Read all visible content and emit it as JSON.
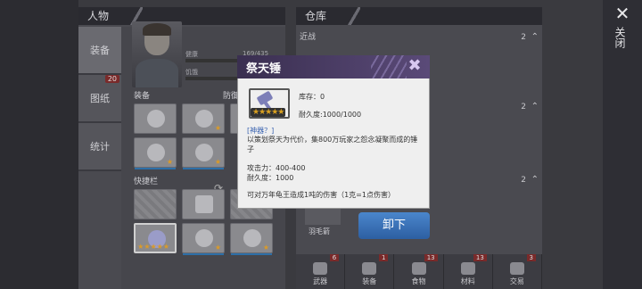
{
  "left_panel": {
    "title": "人物"
  },
  "side_tabs": [
    {
      "label": "装备"
    },
    {
      "label": "图纸",
      "badge": "20"
    },
    {
      "label": "统计"
    }
  ],
  "stats": {
    "health_label": "健康",
    "health_value": "169/435",
    "hunger_label": "饥饿"
  },
  "sections": {
    "equipment": "装备",
    "defense": "防御",
    "quickbar": "快捷栏"
  },
  "right_panel": {
    "title": "仓库",
    "rows": [
      {
        "label": "近战",
        "count": "2"
      },
      {
        "label": "",
        "count": "2"
      },
      {
        "label": "",
        "count": "2"
      }
    ],
    "feather_label": "羽毛箭"
  },
  "bottom_tabs": [
    {
      "label": "武器",
      "badge": "6"
    },
    {
      "label": "装备",
      "badge": "1"
    },
    {
      "label": "食物",
      "badge": "13"
    },
    {
      "label": "材料",
      "badge": "13"
    },
    {
      "label": "交易",
      "badge": "3"
    }
  ],
  "close": {
    "icon": "close-icon",
    "label": "关闭"
  },
  "popup": {
    "title": "祭天锤",
    "stock": "库存：0",
    "durability": "耐久度:1000/1000",
    "stars": "★★★★★",
    "tag": "[神器？]",
    "desc": "以策划祭天为代价，集800万玩家之怨念凝聚而成的锤子",
    "attack": "攻击力：400-400",
    "durability2": "耐久度：1000",
    "effect": "可对万年龟王造成1吨的伤害（1克=1点伤害）"
  },
  "action": {
    "unequip": "卸下"
  },
  "colors": {
    "popup_header": "#4a3d66",
    "button": "#3a73b8",
    "badge": "#7a2a2a",
    "star": "#d9a020"
  }
}
